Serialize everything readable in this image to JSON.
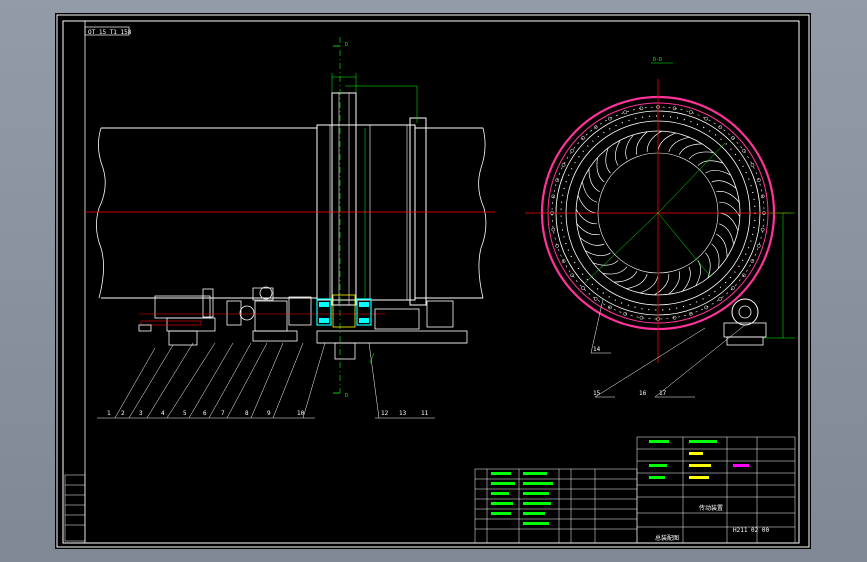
{
  "drawing": {
    "stamp_top_left": "OT 15 T1 158",
    "section_mark_top": "D",
    "section_mark_bottom": "D",
    "section_view_label": "D-D",
    "title_block_name": "传动装置",
    "title_block_drawing_no": "H211 02 00",
    "title_block_sub": "总装配图"
  },
  "balloons_left": [
    "1",
    "2",
    "3",
    "4",
    "5",
    "6",
    "7",
    "8",
    "9",
    "10",
    "12",
    "13",
    "11"
  ],
  "balloons_right": [
    "14",
    "15",
    "16",
    "17"
  ],
  "colors": {
    "background": "#000000",
    "line": "#ffffff",
    "center_line": "#ff0000",
    "dimension": "#00ff00",
    "ring": "#ff3399",
    "highlight": "#00ffff",
    "accent": "#ffff00"
  }
}
